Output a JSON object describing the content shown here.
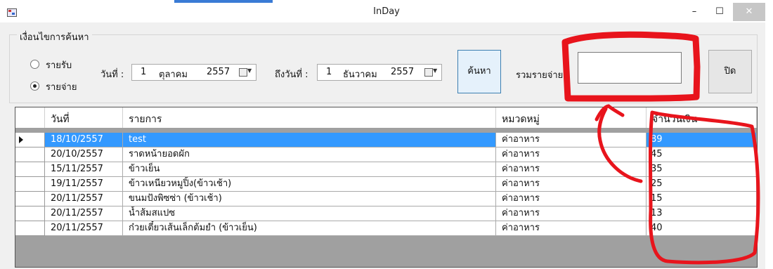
{
  "window": {
    "title": "InDay"
  },
  "titlebar": {
    "minimize": "–",
    "maximize": "☐",
    "close": "✕"
  },
  "search": {
    "group_title": "เงื่อนไขการค้นหา",
    "radios": [
      {
        "label": "รายรับ",
        "checked": false
      },
      {
        "label": "รายจ่าย",
        "checked": true
      }
    ],
    "from_label": "วันที่ :",
    "from_date": {
      "day": "1",
      "month": "ตุลาคม",
      "year": "2557"
    },
    "to_label": "ถึงวันที่ :",
    "to_date": {
      "day": "1",
      "month": "ธันวาคม",
      "year": "2557"
    },
    "search_button": "ค้นหา",
    "total_label": "รวมรายจ่าย",
    "total_value": "",
    "close_button": "ปิด"
  },
  "grid": {
    "columns": [
      "วันที่",
      "รายการ",
      "หมวดหมู่",
      "จำนวนเงิน"
    ],
    "rows": [
      {
        "date": "18/10/2557",
        "item": "test",
        "category": "ค่าอาหาร",
        "amount": "89"
      },
      {
        "date": "20/10/2557",
        "item": "ราดหน้ายอดผัก",
        "category": "ค่าอาหาร",
        "amount": "45"
      },
      {
        "date": "15/11/2557",
        "item": "ข้าวเย็น",
        "category": "ค่าอาหาร",
        "amount": "35"
      },
      {
        "date": "19/11/2557",
        "item": "ข้าวเหนียวหมูปิ้ง(ข้าวเช้า)",
        "category": "ค่าอาหาร",
        "amount": "25"
      },
      {
        "date": "20/11/2557",
        "item": "ขนมปังพิซซ่า (ข้าวเช้า)",
        "category": "ค่าอาหาร",
        "amount": "15"
      },
      {
        "date": "20/11/2557",
        "item": "น้ำส้มสแปซ",
        "category": "ค่าอาหาร",
        "amount": "13"
      },
      {
        "date": "20/11/2557",
        "item": "ก๋วยเตี๋ยวเส้นเล็กต้มยำ (ข้าวเย็น)",
        "category": "ค่าอาหาร",
        "amount": "40"
      }
    ],
    "selected_row": 0
  },
  "colors": {
    "selection": "#3399ff",
    "annotation": "#e8141c",
    "grid_background": "#a0a0a0"
  }
}
